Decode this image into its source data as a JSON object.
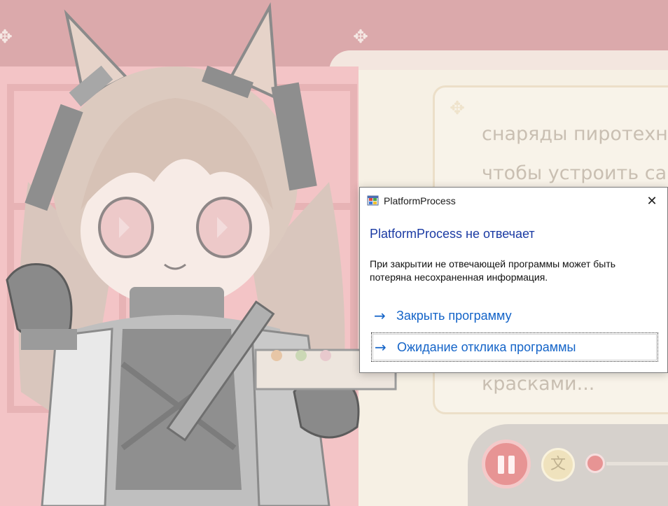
{
  "dialog": {
    "title": "PlatformProcess",
    "heading": "PlatformProcess не отвечает",
    "message": "При закрытии не отвечающей программы может быть потеряна несохраненная информация.",
    "close_glyph": "✕",
    "options": [
      {
        "label": "Закрыть программу",
        "arrow": "→"
      },
      {
        "label": "Ожидание отклика программы",
        "arrow": "→"
      }
    ]
  },
  "game": {
    "dialogue_lines": [
      "снаряды пиротехни",
      "чтобы устроить сам",
      "красками..."
    ],
    "translate_icon": "translate-icon",
    "accent_color": "#e79494"
  }
}
